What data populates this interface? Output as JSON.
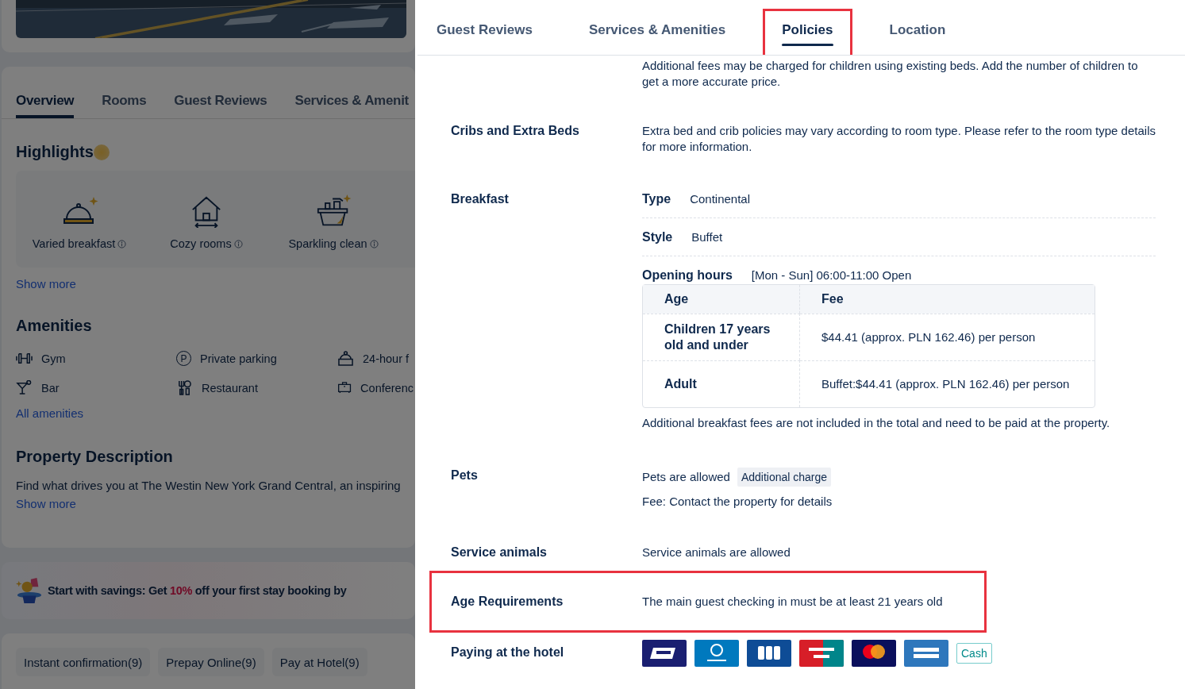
{
  "background_page": {
    "photo": {
      "kind": "picture"
    },
    "tabs": [
      {
        "label": "Overview",
        "selected": true
      },
      {
        "label": "Rooms",
        "selected": false
      },
      {
        "label": "Guest Reviews",
        "selected": false
      },
      {
        "label": "Services & Amenit",
        "selected": false
      }
    ],
    "highlights": {
      "title": "Highlights",
      "items": [
        {
          "label": "Varied breakfast"
        },
        {
          "label": "Cozy rooms"
        },
        {
          "label": "Sparkling clean"
        }
      ],
      "link": "Show more"
    },
    "amenities": {
      "title": "Amenities",
      "items": [
        {
          "label": "Gym"
        },
        {
          "label": "Private parking",
          "glyph": "P"
        },
        {
          "label": "24-hour f"
        },
        {
          "label": "Bar"
        },
        {
          "label": "Restaurant"
        },
        {
          "label": "Conferenc"
        }
      ],
      "link": "All amenities"
    },
    "description": {
      "title": "Property Description",
      "text": "Find what drives you at The Westin New York Grand Central, an inspiring",
      "link": "Show more"
    },
    "promo": {
      "before": "Start with savings: Get",
      "highlight": "10%",
      "after": "off your first stay booking by"
    },
    "filters": [
      "Instant confirmation(9)",
      "Prepay Online(9)",
      "Pay at Hotel(9)"
    ]
  },
  "drawer": {
    "tabs": [
      {
        "label": "Guest Reviews",
        "selected": false,
        "highlighted": false
      },
      {
        "label": "Services & Amenities",
        "selected": false,
        "highlighted": false
      },
      {
        "label": "Policies",
        "selected": true,
        "highlighted": true
      },
      {
        "label": "Location",
        "selected": false,
        "highlighted": false
      }
    ],
    "sections": [
      {
        "kind": "text",
        "highlighted": false,
        "text": "Additional fees may be charged for children using existing beds. Add the number of children to get a more accurate price."
      },
      {
        "kind": "text",
        "highlighted": false,
        "label": "Cribs and Extra Beds",
        "text": "Extra bed and crib policies may vary according to room type. Please refer to the room type details for more information."
      },
      {
        "kind": "breakfast",
        "highlighted": false,
        "label": "Breakfast",
        "details": [
          {
            "label": "Type",
            "value": "Continental"
          },
          {
            "label": "Style",
            "value": "Buffet"
          },
          {
            "label": "Opening hours",
            "value": "[Mon - Sun] 06:00-11:00 Open"
          }
        ],
        "table": {
          "columns": [
            "Age",
            "Fee"
          ],
          "rows": [
            [
              "Children 17 years old and under",
              "$44.41 (approx. PLN 162.46) per person"
            ],
            [
              "Adult",
              "Buffet:$44.41 (approx. PLN 162.46) per person"
            ]
          ]
        },
        "note": "Additional breakfast fees are not included in the total and need to be paid at the property."
      },
      {
        "kind": "pets",
        "highlighted": false,
        "label": "Pets",
        "text": "Pets are allowed",
        "tag": "Additional charge",
        "fee": "Fee: Contact the property for details"
      },
      {
        "kind": "text",
        "highlighted": false,
        "label": "Service animals",
        "text": "Service animals are allowed"
      },
      {
        "kind": "text",
        "highlighted": true,
        "label": "Age Requirements",
        "text": "The main guest checking in must be at least 21 years old"
      },
      {
        "kind": "payment",
        "highlighted": false,
        "label": "Paying at the hotel",
        "cards": [
          {
            "color": "#1a1f71"
          },
          {
            "color": "#0079be"
          },
          {
            "color": "#0e4c96"
          },
          {
            "color": "#d71e28"
          },
          {
            "color": "#0a0f5c"
          },
          {
            "color": "#2e77bc"
          }
        ],
        "cash": "Cash"
      }
    ]
  }
}
